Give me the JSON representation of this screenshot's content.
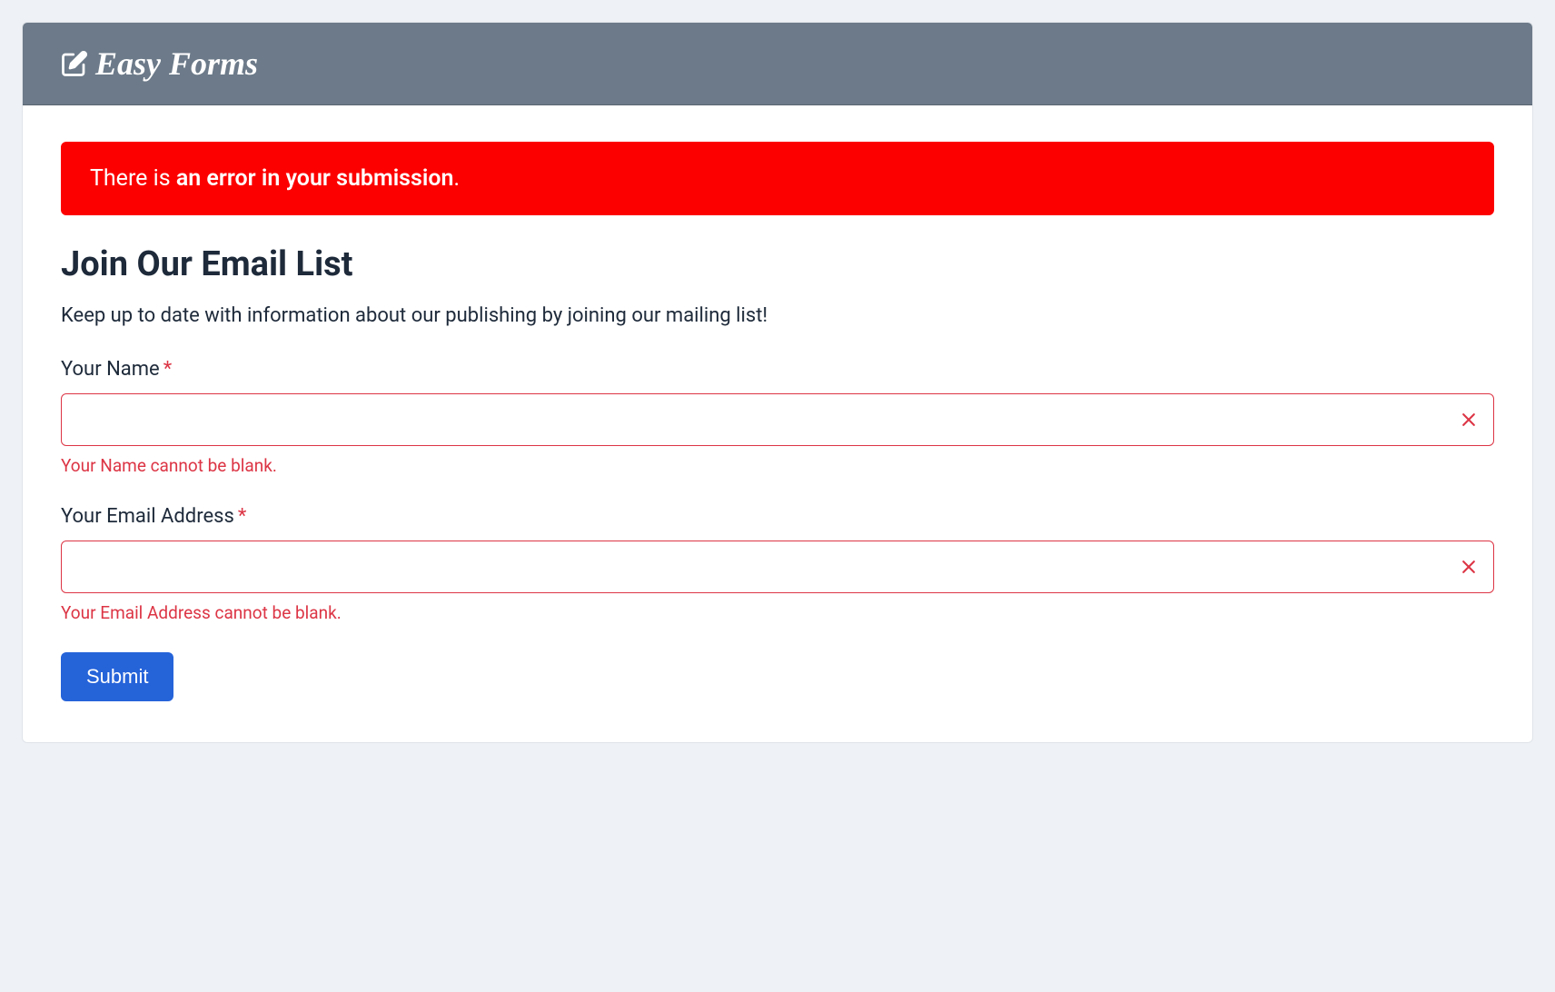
{
  "brand": {
    "name": "Easy Forms"
  },
  "alert": {
    "prefix": "There is ",
    "bold": "an error in your submission",
    "suffix": "."
  },
  "form": {
    "title": "Join Our Email List",
    "description": "Keep up to date with information about our publishing by joining our mailing list!",
    "fields": {
      "name": {
        "label": "Your Name",
        "required": "*",
        "value": "",
        "error": "Your Name cannot be blank."
      },
      "email": {
        "label": "Your Email Address",
        "required": "*",
        "value": "",
        "error": "Your Email Address cannot be blank."
      }
    },
    "submit_label": "Submit"
  }
}
